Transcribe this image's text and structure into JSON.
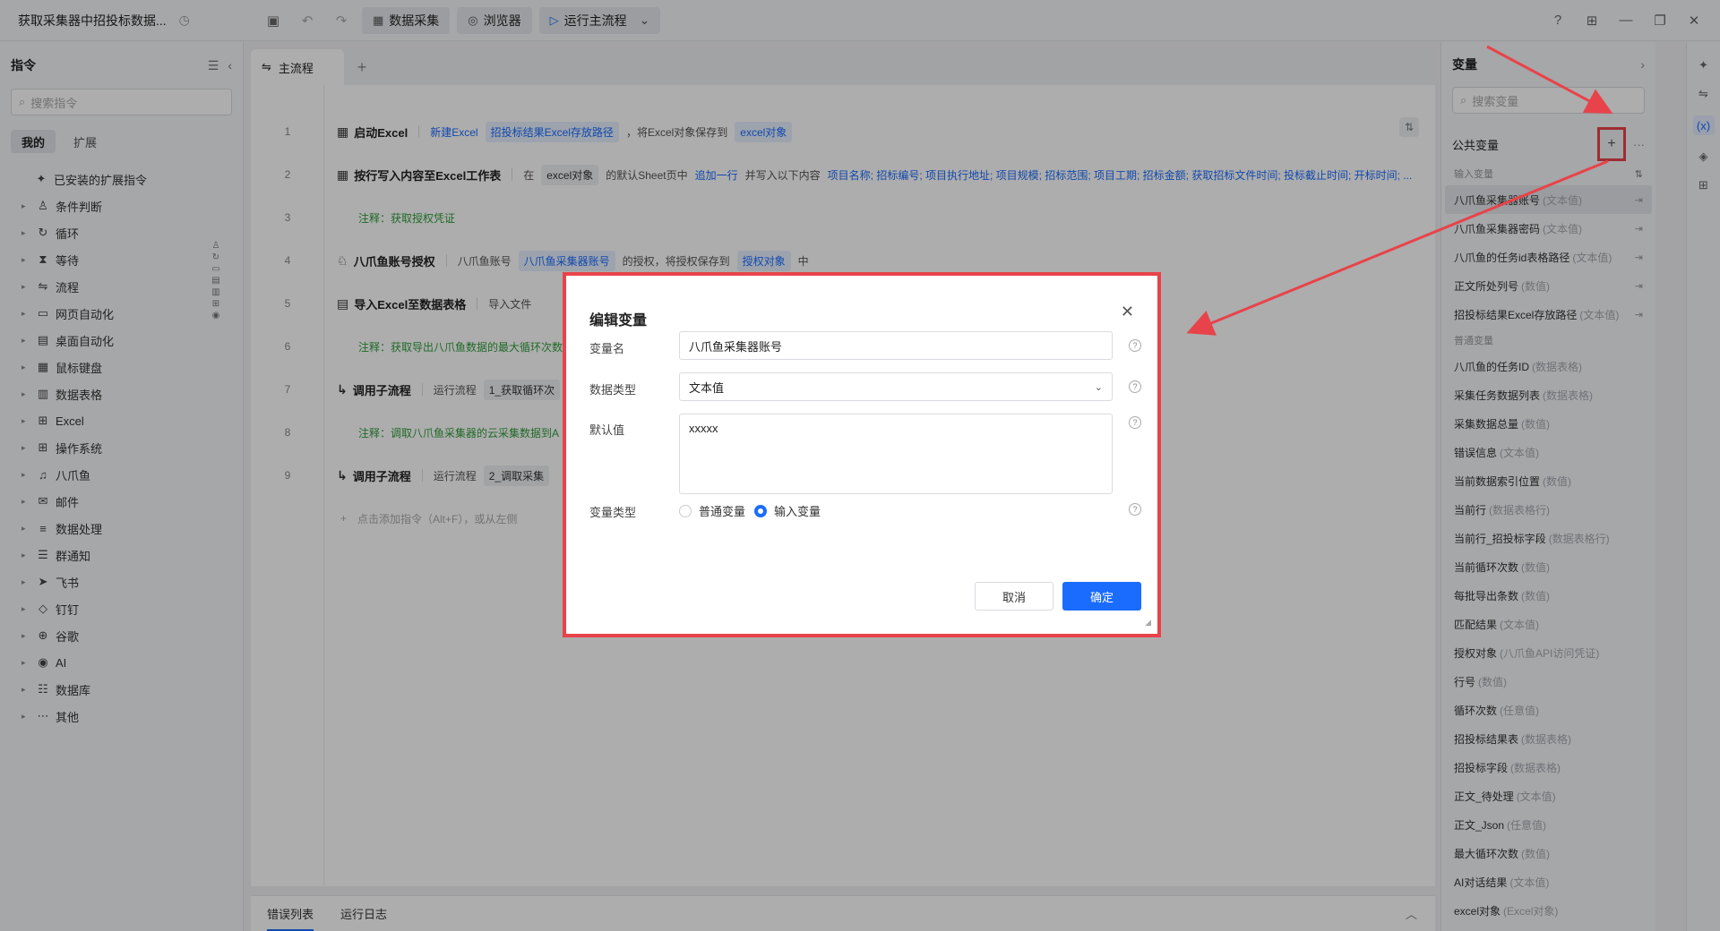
{
  "titlebar": {
    "title": "获取采集器中招投标数据...",
    "data_collect": "数据采集",
    "browser": "浏览器",
    "run_main": "运行主流程"
  },
  "left": {
    "title": "指令",
    "search_placeholder": "搜索指令",
    "tabs": [
      "我的",
      "扩展"
    ],
    "installed": "已安装的扩展指令",
    "items": [
      "条件判断",
      "循环",
      "等待",
      "流程",
      "网页自动化",
      "桌面自动化",
      "鼠标键盘",
      "数据表格",
      "Excel",
      "操作系统",
      "八爪鱼",
      "邮件",
      "数据处理",
      "群通知",
      "飞书",
      "钉钉",
      "谷歌",
      "AI",
      "数据库",
      "其他"
    ]
  },
  "main": {
    "tab": "主流程",
    "rows": [
      {
        "n": "1",
        "cmd": "启动Excel",
        "parts": [
          {
            "t": "link",
            "v": "新建Excel"
          },
          {
            "t": "chip",
            "v": "招投标结果Excel存放路径"
          },
          {
            "t": "text",
            "v": "，将Excel对象保存到"
          },
          {
            "t": "chip",
            "v": "excel对象"
          }
        ]
      },
      {
        "n": "2",
        "cmd": "按行写入内容至Excel工作表",
        "parts": [
          {
            "t": "text",
            "v": "在"
          },
          {
            "t": "sel",
            "v": "excel对象"
          },
          {
            "t": "text",
            "v": "的默认Sheet页中"
          },
          {
            "t": "link",
            "v": "追加一行"
          },
          {
            "t": "text",
            "v": "并写入以下内容"
          },
          {
            "t": "link",
            "v": "项目名称; 招标编号; 项目执行地址; 项目规模; 招标范围; 项目工期; 招标金额; 获取招标文件时间; 投标截止时间; 开标时间; ..."
          }
        ]
      },
      {
        "n": "3",
        "comment": "注释：获取授权凭证"
      },
      {
        "n": "4",
        "cmd": "八爪鱼账号授权",
        "parts": [
          {
            "t": "text",
            "v": "八爪鱼账号"
          },
          {
            "t": "chip",
            "v": "八爪鱼采集器账号"
          },
          {
            "t": "text",
            "v": "的授权，将授权保存到"
          },
          {
            "t": "chip",
            "v": "授权对象"
          },
          {
            "t": "text",
            "v": "中"
          }
        ]
      },
      {
        "n": "5",
        "cmd": "导入Excel至数据表格",
        "parts": [
          {
            "t": "text",
            "v": "导入文件"
          }
        ]
      },
      {
        "n": "6",
        "comment": "注释：获取导出八爪鱼数据的最大循环次数"
      },
      {
        "n": "7",
        "cmd": "调用子流程",
        "parts": [
          {
            "t": "text",
            "v": "运行流程"
          },
          {
            "t": "sel",
            "v": "1_获取循环次"
          }
        ]
      },
      {
        "n": "8",
        "comment": "注释：调取八爪鱼采集器的云采集数据到A"
      },
      {
        "n": "9",
        "cmd": "调用子流程",
        "parts": [
          {
            "t": "text",
            "v": "运行流程"
          },
          {
            "t": "sel",
            "v": "2_调取采集"
          }
        ]
      }
    ],
    "add_hint": "点击添加指令（Alt+F），或从左侧"
  },
  "bottom": {
    "tabs": [
      "错误列表",
      "运行日志"
    ]
  },
  "right": {
    "title": "变量",
    "search_placeholder": "搜索变量",
    "public_title": "公共变量",
    "input_head": "输入变量",
    "normal_head": "普通变量",
    "input_vars": [
      {
        "name": "八爪鱼采集器账号",
        "type": "(文本值)"
      },
      {
        "name": "八爪鱼采集器密码",
        "type": "(文本值)"
      },
      {
        "name": "八爪鱼的任务id表格路径",
        "type": "(文本值)"
      },
      {
        "name": "正文所处列号",
        "type": "(数值)"
      },
      {
        "name": "招投标结果Excel存放路径",
        "type": "(文本值)"
      }
    ],
    "normal_vars": [
      {
        "name": "八爪鱼的任务ID",
        "type": "(数据表格)"
      },
      {
        "name": "采集任务数据列表",
        "type": "(数据表格)"
      },
      {
        "name": "采集数据总量",
        "type": "(数值)"
      },
      {
        "name": "错误信息",
        "type": "(文本值)"
      },
      {
        "name": "当前数据索引位置",
        "type": "(数值)"
      },
      {
        "name": "当前行",
        "type": "(数据表格行)"
      },
      {
        "name": "当前行_招投标字段",
        "type": "(数据表格行)"
      },
      {
        "name": "当前循环次数",
        "type": "(数值)"
      },
      {
        "name": "每批导出条数",
        "type": "(数值)"
      },
      {
        "name": "匹配结果",
        "type": "(文本值)"
      },
      {
        "name": "授权对象",
        "type": "(八爪鱼API访问凭证)"
      },
      {
        "name": "行号",
        "type": "(数值)"
      },
      {
        "name": "循环次数",
        "type": "(任意值)"
      },
      {
        "name": "招投标结果表",
        "type": "(数据表格)"
      },
      {
        "name": "招投标字段",
        "type": "(数据表格)"
      },
      {
        "name": "正文_待处理",
        "type": "(文本值)"
      },
      {
        "name": "正文_Json",
        "type": "(任意值)"
      },
      {
        "name": "最大循环次数",
        "type": "(数值)"
      },
      {
        "name": "AI对话结果",
        "type": "(文本值)"
      },
      {
        "name": "excel对象",
        "type": "(Excel对象)"
      }
    ]
  },
  "dialog": {
    "title": "编辑变量",
    "name_label": "变量名",
    "name_value": "八爪鱼采集器账号",
    "type_label": "数据类型",
    "type_value": "文本值",
    "default_label": "默认值",
    "default_value": "xxxxx",
    "kind_label": "变量类型",
    "kind_normal": "普通变量",
    "kind_input": "输入变量",
    "cancel": "取消",
    "ok": "确定"
  },
  "colors": {
    "accent": "#1a6cff",
    "highlight": "#e8434a",
    "comment": "#2f9d3a"
  }
}
